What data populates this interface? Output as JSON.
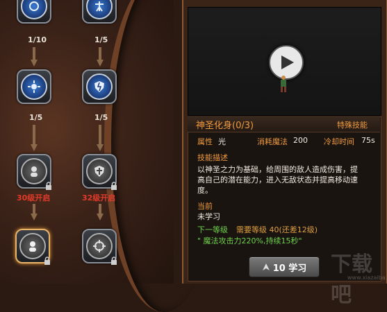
{
  "skill_tree": {
    "column1": [
      {
        "count": "1/10"
      },
      {
        "count": "1/5"
      },
      {
        "unlock": "30级开启"
      }
    ],
    "column2": [
      {
        "count": "1/5"
      },
      {
        "count": "1/5"
      },
      {
        "unlock": "32级开启"
      }
    ]
  },
  "skill_detail": {
    "name": "神圣化身(0/3)",
    "type": "特殊技能",
    "attribute_label": "属性",
    "attribute_value": "光",
    "mana_label": "消耗魔法",
    "mana_value": "200",
    "cooldown_label": "冷却时间",
    "cooldown_value": "75s",
    "desc_title": "技能描述",
    "desc_line1": "以神圣之力为基础，给周围的敌人造成伤害，提",
    "desc_line2": "高自己的潜在能力，进入无敌状态并提高移动速",
    "desc_line3": "度。",
    "current_title": "当前",
    "current_value": "未学习",
    "next_title": "下一等级",
    "next_req": "需要等级 40(还差12级)",
    "next_effect": "\" 魔法攻击力220%,持续15秒\""
  },
  "learn_button": {
    "label": "10 学习"
  },
  "watermark": {
    "text": "下载吧",
    "sub": "www.xiazaiba.com"
  },
  "colors": {
    "accent": "#f09a3e",
    "green": "#6fd24c",
    "red": "#e23a2a"
  }
}
